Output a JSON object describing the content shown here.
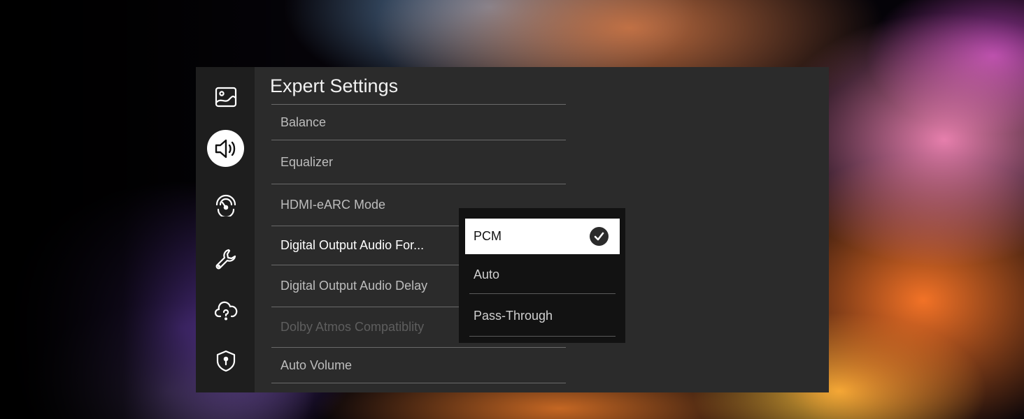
{
  "panel": {
    "title": "Expert Settings"
  },
  "sidebar": {
    "items": [
      {
        "icon": "picture-icon",
        "active": false
      },
      {
        "icon": "sound-icon",
        "active": true
      },
      {
        "icon": "network-icon",
        "active": false
      },
      {
        "icon": "wrench-icon",
        "active": false
      },
      {
        "icon": "cloud-help-icon",
        "active": false
      },
      {
        "icon": "shield-icon",
        "active": false
      }
    ]
  },
  "menu": {
    "items": [
      {
        "label": "Balance",
        "state": "normal"
      },
      {
        "label": "Equalizer",
        "state": "normal"
      },
      {
        "label": "HDMI-eARC Mode",
        "state": "normal"
      },
      {
        "label": "Digital Output Audio For...",
        "state": "focused"
      },
      {
        "label": "Digital Output Audio Delay",
        "state": "normal"
      },
      {
        "label": "Dolby Atmos Compatiblity",
        "state": "disabled"
      },
      {
        "label": "Auto Volume",
        "state": "normal"
      }
    ]
  },
  "dropdown": {
    "options": [
      {
        "label": "PCM",
        "selected": true
      },
      {
        "label": "Auto",
        "selected": false
      },
      {
        "label": "Pass-Through",
        "selected": false
      }
    ]
  },
  "colors": {
    "panel_bg": "#2b2b2b",
    "rail_bg": "#1e1e1e",
    "dropdown_bg": "#121212",
    "selected_bg": "#ffffff"
  }
}
